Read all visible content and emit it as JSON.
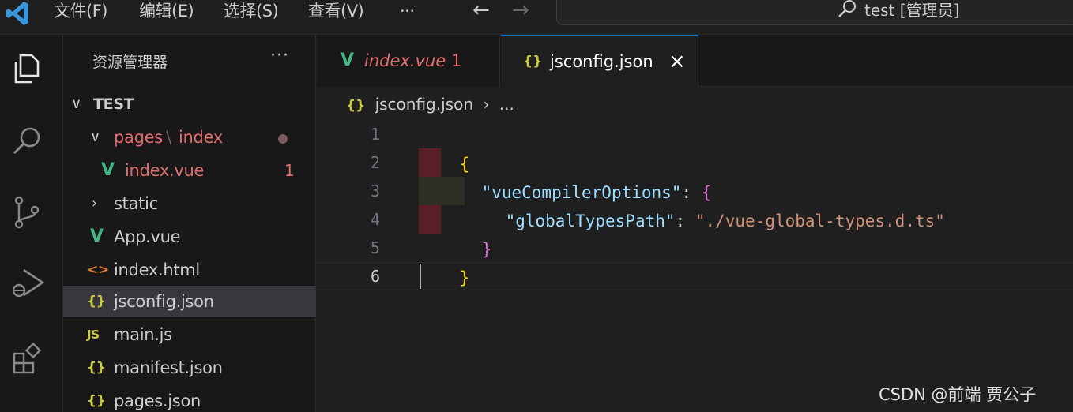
{
  "titlebar": {
    "menus": [
      "文件(F)",
      "编辑(E)",
      "选择(S)",
      "查看(V)",
      "···"
    ],
    "search_text": "test [管理员]"
  },
  "explorer": {
    "title": "资源管理器",
    "more": "···",
    "root": "TEST",
    "folder_pages": "pages",
    "folder_sep": "\\",
    "folder_index": "index",
    "items": {
      "index_vue": "index.vue",
      "index_vue_errors": "1",
      "static": "static",
      "app_vue": "App.vue",
      "index_html": "index.html",
      "jsconfig": "jsconfig.json",
      "main_js": "main.js",
      "manifest": "manifest.json",
      "pages_json": "pages.json"
    },
    "icons": {
      "json": "{}",
      "js": "JS",
      "html": "<>",
      "vue": "V"
    }
  },
  "tabs": {
    "inactive_label": "index.vue",
    "inactive_errors": "1",
    "active_label": "jsconfig.json",
    "close": "×"
  },
  "breadcrumb": {
    "file": "jsconfig.json",
    "sep": "›",
    "rest": "..."
  },
  "editor": {
    "line_numbers": [
      "1",
      "2",
      "3",
      "4",
      "5",
      "6"
    ],
    "line1": "{",
    "line2_key": "\"vueCompilerOptions\"",
    "line2_colon": ": ",
    "line2_brace": "{",
    "line3_key": "\"globalTypesPath\"",
    "line3_colon": ": ",
    "line3_val": "\"./vue-global-types.d.ts\"",
    "line4": "}",
    "line5": "}"
  },
  "watermark": "CSDN @前端 贾公子",
  "colors": {
    "vue_green": "#41b883",
    "json_yellow": "#cbcb41",
    "error_red": "#e06c6c",
    "html_orange": "#e37933",
    "accent": "#0078d4"
  }
}
